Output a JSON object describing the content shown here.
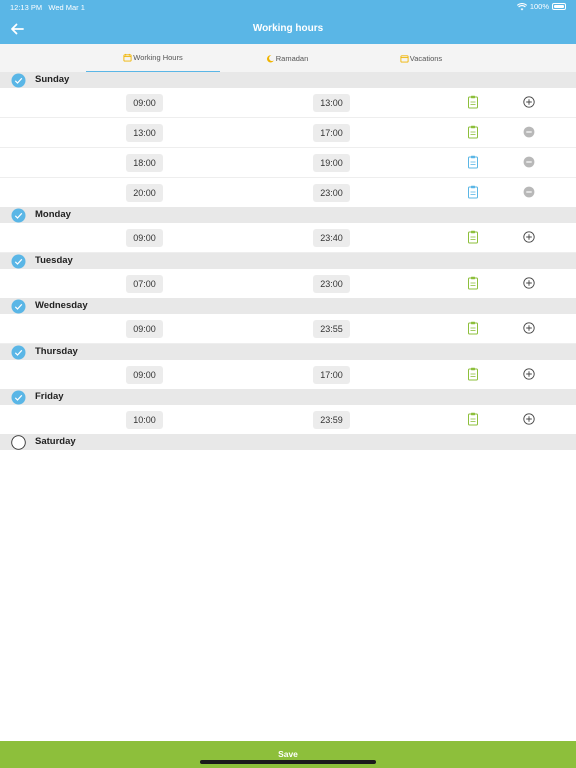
{
  "status_bar": {
    "time": "12:13 PM",
    "date": "Wed Mar 1",
    "battery": "100%"
  },
  "header": {
    "title": "Working hours"
  },
  "tabs": [
    {
      "label": "Working Hours",
      "active": true
    },
    {
      "label": "Ramadan",
      "active": false
    },
    {
      "label": "Vacations",
      "active": false
    }
  ],
  "days": [
    {
      "name": "Sunday",
      "checked": true,
      "slots": [
        {
          "start": "09:00",
          "end": "13:00",
          "clip": "green",
          "action": "add"
        },
        {
          "start": "13:00",
          "end": "17:00",
          "clip": "green",
          "action": "remove"
        },
        {
          "start": "18:00",
          "end": "19:00",
          "clip": "blue",
          "action": "remove"
        },
        {
          "start": "20:00",
          "end": "23:00",
          "clip": "blue",
          "action": "remove"
        }
      ]
    },
    {
      "name": "Monday",
      "checked": true,
      "slots": [
        {
          "start": "09:00",
          "end": "23:40",
          "clip": "green",
          "action": "add"
        }
      ]
    },
    {
      "name": "Tuesday",
      "checked": true,
      "slots": [
        {
          "start": "07:00",
          "end": "23:00",
          "clip": "green",
          "action": "add"
        }
      ]
    },
    {
      "name": "Wednesday",
      "checked": true,
      "slots": [
        {
          "start": "09:00",
          "end": "23:55",
          "clip": "green",
          "action": "add"
        }
      ]
    },
    {
      "name": "Thursday",
      "checked": true,
      "slots": [
        {
          "start": "09:00",
          "end": "17:00",
          "clip": "green",
          "action": "add"
        }
      ]
    },
    {
      "name": "Friday",
      "checked": true,
      "slots": [
        {
          "start": "10:00",
          "end": "23:59",
          "clip": "green",
          "action": "add"
        }
      ]
    },
    {
      "name": "Saturday",
      "checked": false,
      "slots": []
    }
  ],
  "footer": {
    "save_label": "Save"
  },
  "colors": {
    "header": "#5ab6e6",
    "save": "#8dbf3b",
    "clip_green": "#8dbf3b",
    "clip_blue": "#5ab6e6",
    "tab_icon": "#f0b400"
  }
}
